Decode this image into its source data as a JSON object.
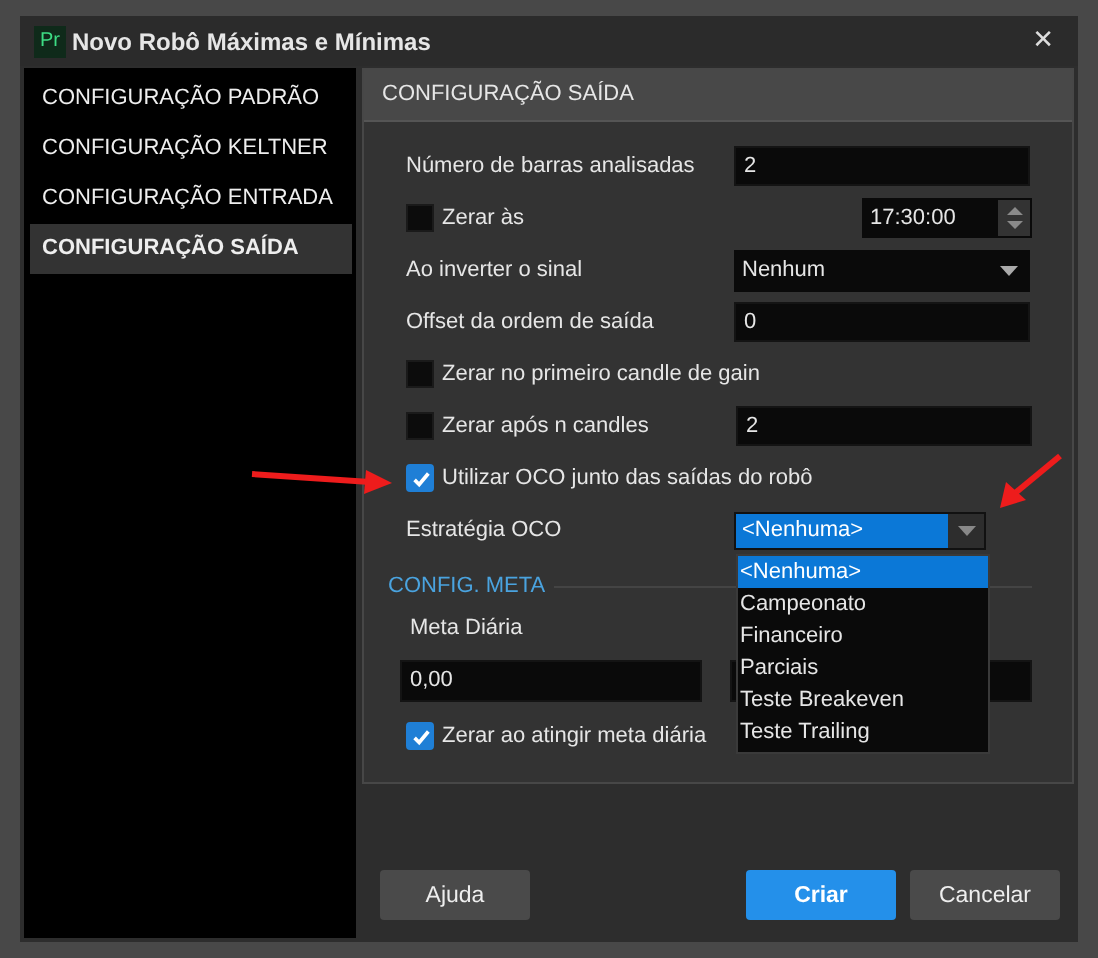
{
  "window": {
    "icon_text": "Pr",
    "title": "Novo Robô Máximas e Mínimas",
    "close": "✕"
  },
  "sidebar": {
    "items": [
      {
        "label": "CONFIGURAÇÃO PADRÃO",
        "selected": false
      },
      {
        "label": "CONFIGURAÇÃO KELTNER",
        "selected": false
      },
      {
        "label": "CONFIGURAÇÃO ENTRADA",
        "selected": false
      },
      {
        "label": "CONFIGURAÇÃO SAÍDA",
        "selected": true
      }
    ]
  },
  "panel": {
    "title": "CONFIGURAÇÃO SAÍDA",
    "rows": [
      {
        "kind": "field",
        "label": "Número de barras analisadas",
        "value": "2"
      },
      {
        "kind": "check-spin",
        "label": "Zerar às",
        "checked": false,
        "value": "17:30:00"
      },
      {
        "kind": "select",
        "label": "Ao inverter o sinal",
        "value": "Nenhum"
      },
      {
        "kind": "field",
        "label": "Offset da ordem de saída",
        "value": "0"
      },
      {
        "kind": "check",
        "label": "Zerar no primeiro candle de gain",
        "checked": false
      },
      {
        "kind": "check-field",
        "label": "Zerar após n candles",
        "checked": false,
        "value": "2"
      },
      {
        "kind": "check",
        "label": "Utilizar OCO junto das saídas do robô",
        "checked": true
      },
      {
        "kind": "combo",
        "label": "Estratégia OCO",
        "value": "<Nenhuma>",
        "options": [
          {
            "label": "<Nenhuma>",
            "selected": true
          },
          {
            "label": "Campeonato",
            "selected": false
          },
          {
            "label": "Financeiro",
            "selected": false
          },
          {
            "label": "Parciais",
            "selected": false
          },
          {
            "label": "Teste Breakeven",
            "selected": false
          },
          {
            "label": "Teste Trailing",
            "selected": false
          }
        ]
      }
    ],
    "meta": {
      "title": "CONFIG. META",
      "label": "Meta Diária",
      "value": "0,00",
      "check_label": "Zerar ao atingir meta diária",
      "checked": true
    }
  },
  "buttons": [
    {
      "label": "Ajuda",
      "primary": false
    },
    {
      "label": "Criar",
      "primary": true
    },
    {
      "label": "Cancelar",
      "primary": false
    }
  ]
}
